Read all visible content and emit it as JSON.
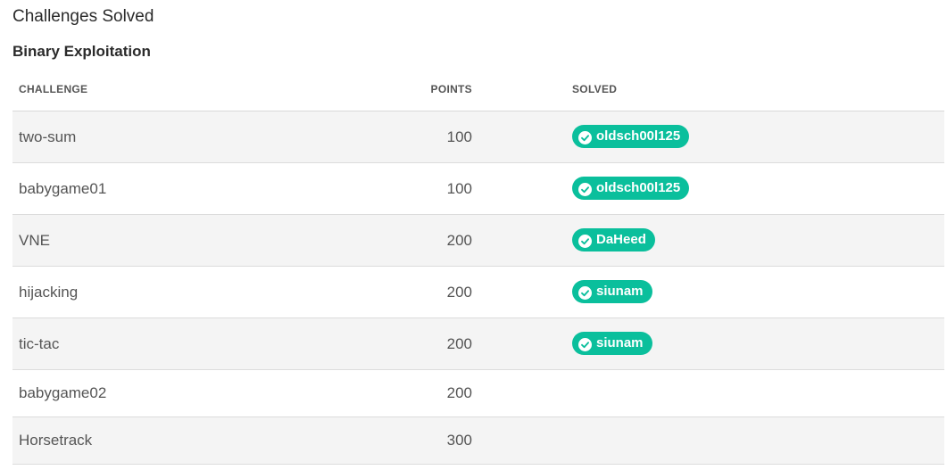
{
  "page": {
    "title": "Challenges Solved"
  },
  "section": {
    "title": "Binary Exploitation"
  },
  "table": {
    "headers": {
      "challenge": "CHALLENGE",
      "points": "POINTS",
      "solved": "SOLVED"
    },
    "rows": [
      {
        "challenge": "two-sum",
        "points": "100",
        "solved_by": "oldsch00l125"
      },
      {
        "challenge": "babygame01",
        "points": "100",
        "solved_by": "oldsch00l125"
      },
      {
        "challenge": "VNE",
        "points": "200",
        "solved_by": "DaHeed"
      },
      {
        "challenge": "hijacking",
        "points": "200",
        "solved_by": "siunam"
      },
      {
        "challenge": "tic-tac",
        "points": "200",
        "solved_by": "siunam"
      },
      {
        "challenge": "babygame02",
        "points": "200",
        "solved_by": ""
      },
      {
        "challenge": "Horsetrack",
        "points": "300",
        "solved_by": ""
      }
    ]
  },
  "colors": {
    "badge_bg": "#0abf9c",
    "stripe_bg": "#f4f4f4"
  },
  "icons": {
    "solved_badge": "check-circle-icon"
  }
}
